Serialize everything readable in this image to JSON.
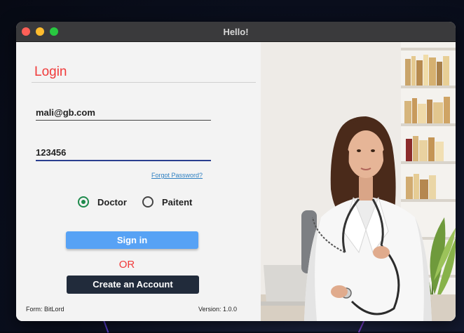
{
  "window": {
    "title": "Hello!"
  },
  "login": {
    "heading": "Login",
    "email_value": "mali@gb.com",
    "password_value": "123456",
    "forgot_password": "Forgot Password?",
    "roles": [
      {
        "label": "Doctor",
        "selected": true
      },
      {
        "label": "Paitent",
        "selected": false
      }
    ],
    "signin_label": "Sign in",
    "or_label": "OR",
    "create_account_label": "Create an Account"
  },
  "footer": {
    "form_label": "Form: BitLord",
    "version_label": "Version: 1.0.0"
  },
  "colors": {
    "accent_red": "#f03a3a",
    "signin_blue": "#57a2f5",
    "create_dark": "#212b3b",
    "radio_green": "#1e8a4c"
  },
  "icons": [
    "close-icon",
    "minimize-icon",
    "zoom-icon",
    "doctor-photo"
  ]
}
